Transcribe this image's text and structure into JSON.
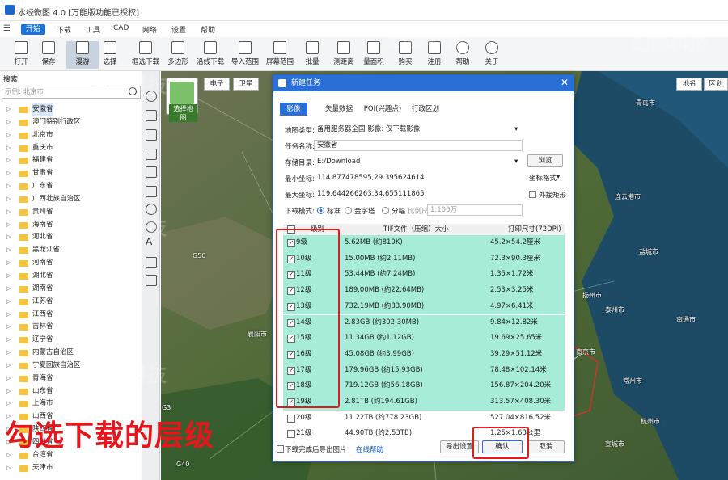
{
  "app": {
    "title": "水经微图 4.0 [万能版功能已授权]"
  },
  "menu": {
    "start": "开始",
    "items": [
      "下载",
      "工具",
      "CAD",
      "网络",
      "设置",
      "帮助"
    ]
  },
  "toolbar": {
    "items": [
      "打开",
      "保存",
      "漫游",
      "选择",
      "框选下载",
      "多边形",
      "沿线下载",
      "导入范围",
      "屏幕范围",
      "批量",
      "测距离",
      "量面积",
      "购买",
      "注册",
      "帮助",
      "关于"
    ]
  },
  "sidebar": {
    "title": "搜索",
    "placeholder": "示例: 北京市",
    "provinces": [
      "安徽省",
      "澳门特别行政区",
      "北京市",
      "重庆市",
      "福建省",
      "甘肃省",
      "广东省",
      "广西壮族自治区",
      "贵州省",
      "海南省",
      "河北省",
      "黑龙江省",
      "河南省",
      "湖北省",
      "湖南省",
      "江苏省",
      "江西省",
      "吉林省",
      "辽宁省",
      "内蒙古自治区",
      "宁夏回族自治区",
      "青海省",
      "山东省",
      "上海市",
      "山西省",
      "陕西省",
      "四川省",
      "台湾省",
      "天津市"
    ]
  },
  "map": {
    "layer_button": "选择地图",
    "tabs": [
      "电子",
      "卫星"
    ],
    "right_tabs": [
      "地名",
      "区划"
    ],
    "labels": [
      "青岛市",
      "连云港市",
      "盐城市",
      "扬州市",
      "泰州市",
      "南通市",
      "南京市",
      "常州市",
      "杭州市",
      "宣城市",
      "襄阳市",
      "G50",
      "G40",
      "G3"
    ]
  },
  "dialog": {
    "title": "新建任务",
    "tabs": [
      "影像",
      "矢量数据",
      "POI(兴趣点)",
      "行政区划"
    ],
    "map_type_label": "地图类型:",
    "map_type": "备用服务器全国 影像: 仅下载影像",
    "task_name_label": "任务名称:",
    "task_name": "安徽省",
    "save_dir_label": "存储目录:",
    "save_dir": "E:/Download",
    "browse": "浏览",
    "min_coord_label": "最小坐标:",
    "min_coord": "114.877478595,29.395624614",
    "coord_format": "坐标格式",
    "max_coord_label": "最大坐标:",
    "max_coord": "119.644266263,34.655111865",
    "outer_rect": "外接矩形",
    "download_mode_label": "下载模式:",
    "modes": [
      "标准",
      "金字塔",
      "分幅"
    ],
    "scale_label": "比例尺:",
    "scale": "1:100万",
    "columns": [
      "级别",
      "TIF文件（压缩）大小",
      "打印尺寸(72DPI)"
    ],
    "levels": [
      {
        "level": "9级",
        "size": "5.62MB (约810K)",
        "print": "45.2×54.2厘米",
        "checked": true
      },
      {
        "level": "10级",
        "size": "15.00MB (约2.11MB)",
        "print": "72.3×90.3厘米",
        "checked": true
      },
      {
        "level": "11级",
        "size": "53.44MB (约7.24MB)",
        "print": "1.35×1.72米",
        "checked": true
      },
      {
        "level": "12级",
        "size": "189.00MB (约22.64MB)",
        "print": "2.53×3.25米",
        "checked": true
      },
      {
        "level": "13级",
        "size": "732.19MB (约83.90MB)",
        "print": "4.97×6.41米",
        "checked": true
      },
      {
        "level": "14级",
        "size": "2.83GB (约302.30MB)",
        "print": "9.84×12.82米",
        "checked": true
      },
      {
        "level": "15级",
        "size": "11.34GB (约1.12GB)",
        "print": "19.69×25.65米",
        "checked": true
      },
      {
        "level": "16级",
        "size": "45.08GB (约3.99GB)",
        "print": "39.29×51.12米",
        "checked": true
      },
      {
        "level": "17级",
        "size": "179.96GB (约15.93GB)",
        "print": "78.48×102.14米",
        "checked": true
      },
      {
        "level": "18级",
        "size": "719.12GB (约56.18GB)",
        "print": "156.87×204.20米",
        "checked": true
      },
      {
        "level": "19级",
        "size": "2.81TB (约194.61GB)",
        "print": "313.57×408.30米",
        "checked": true
      },
      {
        "level": "20级",
        "size": "11.22TB (约778.23GB)",
        "print": "527.04×816.52米",
        "checked": false
      },
      {
        "level": "21级",
        "size": "44.90TB (约2.53TB)",
        "print": "1.25×1.63公里",
        "checked": false
      }
    ],
    "bottom_note": "下载完成后导出图片",
    "bottom_link": "在线帮助",
    "export_settings": "导出设置",
    "confirm": "确认",
    "cancel": "取消"
  },
  "caption": "勾选下载的层级",
  "watermark": "幻暴科技"
}
